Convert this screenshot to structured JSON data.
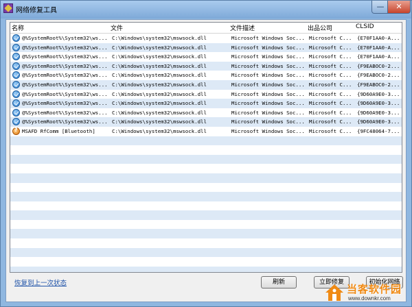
{
  "window": {
    "title": "网络修复工具",
    "minimize": "—",
    "close": "✕"
  },
  "table": {
    "headers": {
      "name": "名称",
      "file": "文件",
      "desc": "文件描述",
      "company": "出品公司",
      "clsid": "CLSID"
    },
    "rows": [
      {
        "icon": "check-circle-icon",
        "name": "@%SystemRoot%\\System32\\ws...",
        "file": "C:\\Windows\\system32\\mswsock.dll",
        "desc": "Microsoft Windows Soc...",
        "company": "Microsoft C...",
        "clsid": "{E70F1AA0-A..."
      },
      {
        "icon": "check-circle-icon",
        "name": "@%SystemRoot%\\System32\\ws...",
        "file": "C:\\Windows\\system32\\mswsock.dll",
        "desc": "Microsoft Windows Soc...",
        "company": "Microsoft C...",
        "clsid": "{E70F1AA0-A..."
      },
      {
        "icon": "check-circle-icon",
        "name": "@%SystemRoot%\\System32\\ws...",
        "file": "C:\\Windows\\system32\\mswsock.dll",
        "desc": "Microsoft Windows Soc...",
        "company": "Microsoft C...",
        "clsid": "{E70F1AA0-A..."
      },
      {
        "icon": "check-circle-icon",
        "name": "@%SystemRoot%\\System32\\ws...",
        "file": "C:\\Windows\\system32\\mswsock.dll",
        "desc": "Microsoft Windows Soc...",
        "company": "Microsoft C...",
        "clsid": "{F9EABOC0-2..."
      },
      {
        "icon": "check-circle-icon",
        "name": "@%SystemRoot%\\System32\\ws...",
        "file": "C:\\Windows\\system32\\mswsock.dll",
        "desc": "Microsoft Windows Soc...",
        "company": "Microsoft C...",
        "clsid": "{F9EABOC0-2..."
      },
      {
        "icon": "check-circle-icon",
        "name": "@%SystemRoot%\\System32\\ws...",
        "file": "C:\\Windows\\system32\\mswsock.dll",
        "desc": "Microsoft Windows Soc...",
        "company": "Microsoft C...",
        "clsid": "{F9EABOC0-2..."
      },
      {
        "icon": "check-circle-icon",
        "name": "@%SystemRoot%\\System32\\ws...",
        "file": "C:\\Windows\\system32\\mswsock.dll",
        "desc": "Microsoft Windows Soc...",
        "company": "Microsoft C...",
        "clsid": "{9D60A9E0-3..."
      },
      {
        "icon": "check-circle-icon",
        "name": "@%SystemRoot%\\System32\\ws...",
        "file": "C:\\Windows\\system32\\mswsock.dll",
        "desc": "Microsoft Windows Soc...",
        "company": "Microsoft C...",
        "clsid": "{9D60A9E0-3..."
      },
      {
        "icon": "check-circle-icon",
        "name": "@%SystemRoot%\\System32\\ws...",
        "file": "C:\\Windows\\system32\\mswsock.dll",
        "desc": "Microsoft Windows Soc...",
        "company": "Microsoft C...",
        "clsid": "{9D60A9E0-3..."
      },
      {
        "icon": "check-circle-icon",
        "name": "@%SystemRoot%\\System32\\ws...",
        "file": "C:\\Windows\\system32\\mswsock.dll",
        "desc": "Microsoft Windows Soc...",
        "company": "Microsoft C...",
        "clsid": "{9D60A9E0-3..."
      },
      {
        "icon": "question-circle-icon",
        "name": "MSAFD RfComm [Bluetooth]",
        "file": "C:\\Windows\\system32\\mswsock.dll",
        "desc": "Microsoft Windows Soc...",
        "company": "Microsoft C...",
        "clsid": "{9FC48064-7..."
      }
    ]
  },
  "footer": {
    "restore_link": "恢复到上一次状态",
    "refresh": "刷新",
    "repair": "立即修复",
    "init": "初始化网络"
  },
  "watermark": {
    "text": "当客软件园",
    "url": "www.downkr.com"
  },
  "colors": {
    "row_alt": "#dde9f6",
    "title_bar": "#8fb7e0",
    "link": "#1e52a8"
  }
}
